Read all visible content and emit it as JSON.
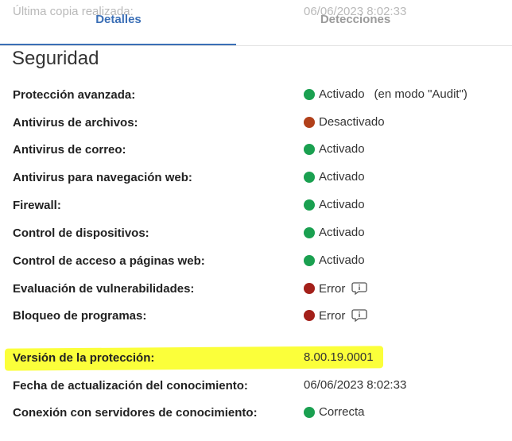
{
  "ghost": {
    "label": "Última copia realizada:",
    "value": "06/06/2023 8:02:33"
  },
  "tabs": [
    {
      "label": "Detalles",
      "active": true
    },
    {
      "label": "Detecciones",
      "active": false
    }
  ],
  "section": {
    "title": "Seguridad"
  },
  "rows": [
    {
      "label": "Protección avanzada:",
      "status": "Activado",
      "extra": "(en modo \"Audit\")",
      "dot": "green"
    },
    {
      "label": "Antivirus de archivos:",
      "status": "Desactivado",
      "dot": "brown"
    },
    {
      "label": "Antivirus de correo:",
      "status": "Activado",
      "dot": "green"
    },
    {
      "label": "Antivirus para navegación web:",
      "status": "Activado",
      "dot": "green"
    },
    {
      "label": "Firewall:",
      "status": "Activado",
      "dot": "green"
    },
    {
      "label": "Control de dispositivos:",
      "status": "Activado",
      "dot": "green"
    },
    {
      "label": "Control de acceso a páginas web:",
      "status": "Activado",
      "dot": "green"
    },
    {
      "label": "Evaluación de vulnerabilidades:",
      "status": "Error",
      "dot": "red",
      "icon": "info-icon"
    },
    {
      "label": "Bloqueo de programas:",
      "status": "Error",
      "dot": "red",
      "icon": "info-icon"
    }
  ],
  "protection_version": {
    "label": "Versión de la protección:",
    "value": "8.00.19.0001"
  },
  "knowledge_update": {
    "label": "Fecha de actualización del conocimiento:",
    "value": "06/06/2023 8:02:33"
  },
  "knowledge_connection": {
    "label": "Conexión con servidores de conocimiento:",
    "status": "Correcta",
    "dot": "green"
  },
  "colors": {
    "accent": "#3b6fb6",
    "ok": "#1aa050",
    "disabled": "#b1401a",
    "error": "#a3201a",
    "highlight": "#fbff3a"
  }
}
